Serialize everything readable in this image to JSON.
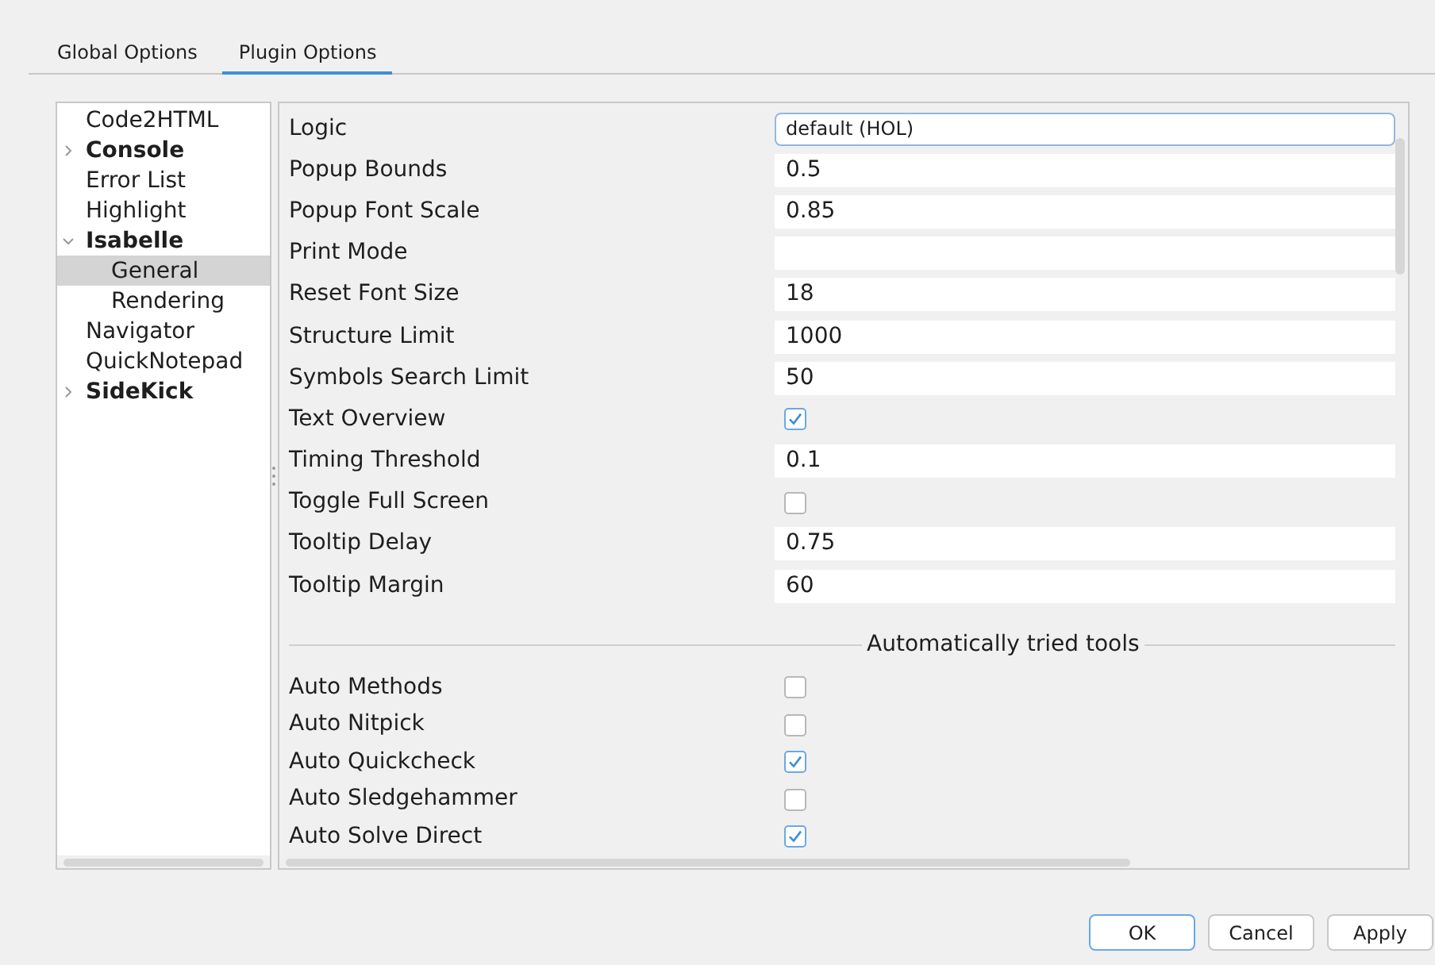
{
  "tabs": [
    {
      "label": "Global Options",
      "selected": false
    },
    {
      "label": "Plugin Options",
      "selected": true
    }
  ],
  "tree": [
    {
      "label": "Code2HTML",
      "bold": false,
      "selected": false
    },
    {
      "label": "Console",
      "bold": true,
      "expanded": false,
      "selected": false
    },
    {
      "label": "Error List",
      "bold": false,
      "selected": false
    },
    {
      "label": "Highlight",
      "bold": false,
      "selected": false
    },
    {
      "label": "Isabelle",
      "bold": true,
      "expanded": true,
      "selected": false,
      "children": [
        {
          "label": "General",
          "bold": false,
          "selected": true
        },
        {
          "label": "Rendering",
          "bold": false,
          "selected": false
        }
      ]
    },
    {
      "label": "Navigator",
      "bold": false,
      "selected": false
    },
    {
      "label": "QuickNotepad",
      "bold": false,
      "selected": false
    },
    {
      "label": "SideKick",
      "bold": true,
      "expanded": false,
      "selected": false
    }
  ],
  "options": [
    {
      "kind": "text",
      "label": "Logic",
      "value": "default (HOL)",
      "focused": true
    },
    {
      "kind": "text",
      "label": "Popup Bounds",
      "value": "0.5",
      "focused": false
    },
    {
      "kind": "text",
      "label": "Popup Font Scale",
      "value": "0.85",
      "focused": false
    },
    {
      "kind": "text",
      "label": "Print Mode",
      "focused": false
    },
    {
      "kind": "text",
      "label": "Reset Font Size",
      "value": "18",
      "focused": false
    },
    {
      "kind": "text",
      "label": "Structure Limit",
      "value": "1000",
      "focused": false
    },
    {
      "kind": "text",
      "label": "Symbols Search Limit",
      "value": "50",
      "focused": false
    },
    {
      "kind": "checkbox",
      "label": "Text Overview",
      "checked": true
    },
    {
      "kind": "text",
      "label": "Timing Threshold",
      "value": "0.1",
      "focused": false
    },
    {
      "kind": "checkbox",
      "label": "Toggle Full Screen",
      "checked": false
    },
    {
      "kind": "text",
      "label": "Tooltip Delay",
      "value": "0.75",
      "focused": false
    },
    {
      "kind": "text",
      "label": "Tooltip Margin",
      "value": "60",
      "focused": false
    }
  ],
  "section": {
    "title": "Automatically tried tools",
    "options": [
      {
        "kind": "checkbox",
        "label": "Auto Methods",
        "checked": false
      },
      {
        "kind": "checkbox",
        "label": "Auto Nitpick",
        "checked": false
      },
      {
        "kind": "checkbox",
        "label": "Auto Quickcheck",
        "checked": true
      },
      {
        "kind": "checkbox",
        "label": "Auto Sledgehammer",
        "checked": false
      },
      {
        "kind": "checkbox",
        "label": "Auto Solve Direct",
        "checked": true
      }
    ]
  },
  "buttons": [
    {
      "label": "OK",
      "default": true
    },
    {
      "label": "Cancel",
      "default": false
    },
    {
      "label": "Apply",
      "default": false
    }
  ]
}
